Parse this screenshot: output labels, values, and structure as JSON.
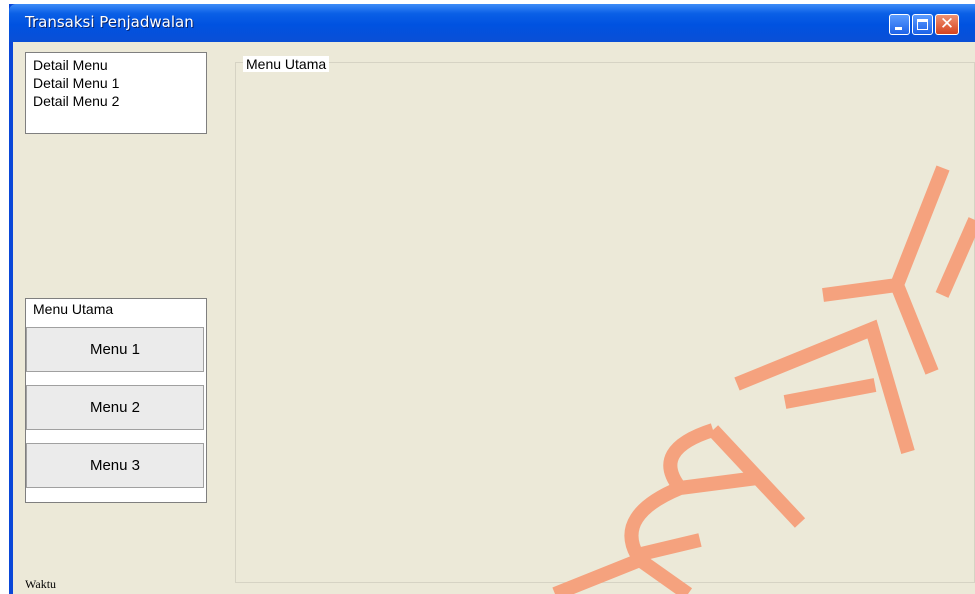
{
  "window": {
    "title": "Transaksi Penjadwalan",
    "controls": [
      "minimize",
      "maximize",
      "close"
    ],
    "title_bar_color": "#0a5fe6",
    "client_color": "#ece9d8"
  },
  "detail_list": {
    "items": [
      "Detail Menu",
      "Detail Menu 1",
      "Detail Menu 2"
    ]
  },
  "menu_panel": {
    "title": "Menu Utama",
    "buttons": [
      "Menu 1",
      "Menu 2",
      "Menu 3"
    ]
  },
  "main_group": {
    "title": "Menu Utama"
  },
  "status": {
    "label": "Waktu"
  },
  "watermark": {
    "color": "#f5a27e"
  }
}
